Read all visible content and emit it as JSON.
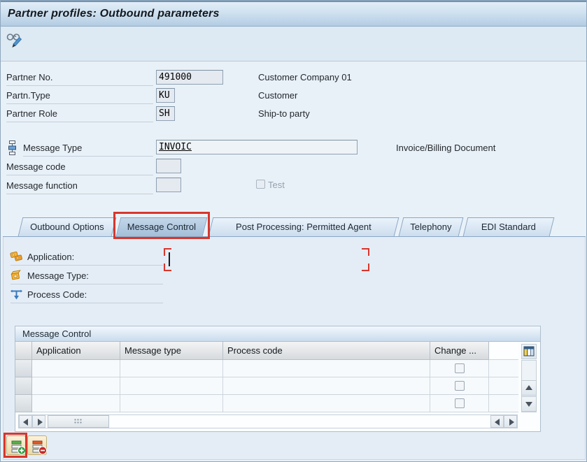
{
  "window": {
    "title": "Partner profiles: Outbound parameters"
  },
  "toolbar": {
    "buttons": [
      {
        "name": "display-change",
        "icon": "glasses-pencil-icon"
      }
    ]
  },
  "partner_fields": [
    {
      "label": "Partner No.",
      "value": "491000",
      "description": "Customer Company 01"
    },
    {
      "label": "Partn.Type",
      "value": "KU",
      "description": "Customer"
    },
    {
      "label": "Partner Role",
      "value": "SH",
      "description": "Ship-to party"
    }
  ],
  "message_fields": {
    "type": {
      "label": "Message Type",
      "value": "INVOIC",
      "description": "Invoice/Billing Document",
      "icon": "hierarchy-icon"
    },
    "code": {
      "label": "Message code",
      "value": ""
    },
    "function": {
      "label": "Message function",
      "value": "",
      "checkbox_label": "Test",
      "checkbox_checked": false
    }
  },
  "tabs": [
    {
      "label": "Outbound Options",
      "active": false
    },
    {
      "label": "Message Control",
      "active": true,
      "highlighted": true
    },
    {
      "label": "Post Processing: Permitted Agent",
      "active": false
    },
    {
      "label": "Telephony",
      "active": false
    },
    {
      "label": "EDI Standard",
      "active": false
    }
  ],
  "tab_panel": {
    "fields": [
      {
        "label": "Application:",
        "icon": "application-icon",
        "value": ""
      },
      {
        "label": "Message Type:",
        "icon": "package-icon",
        "value": ""
      },
      {
        "label": "Process Code:",
        "icon": "process-arrow-icon",
        "value": ""
      }
    ]
  },
  "message_control_table": {
    "title": "Message Control",
    "columns": [
      "Application",
      "Message type",
      "Process code",
      "Change ..."
    ],
    "rows": [
      {
        "application": "",
        "message_type": "",
        "process_code": "",
        "change": false
      },
      {
        "application": "",
        "message_type": "",
        "process_code": "",
        "change": false
      },
      {
        "application": "",
        "message_type": "",
        "process_code": "",
        "change": false
      }
    ]
  },
  "footer": {
    "buttons": [
      {
        "name": "insert-row",
        "icon": "insert-row-icon",
        "highlighted": true
      },
      {
        "name": "delete-row",
        "icon": "delete-row-icon",
        "highlighted": false
      }
    ]
  },
  "annotations": {
    "color": "#d7362c",
    "items": [
      "message-control-tab-box",
      "application-field-corner-marks",
      "insert-row-button-box"
    ]
  },
  "colors": {
    "annotation_red": "#d7362c",
    "titlebar_gradient_bottom": "#b3cce3",
    "content_bg": "#e9f1f8"
  }
}
